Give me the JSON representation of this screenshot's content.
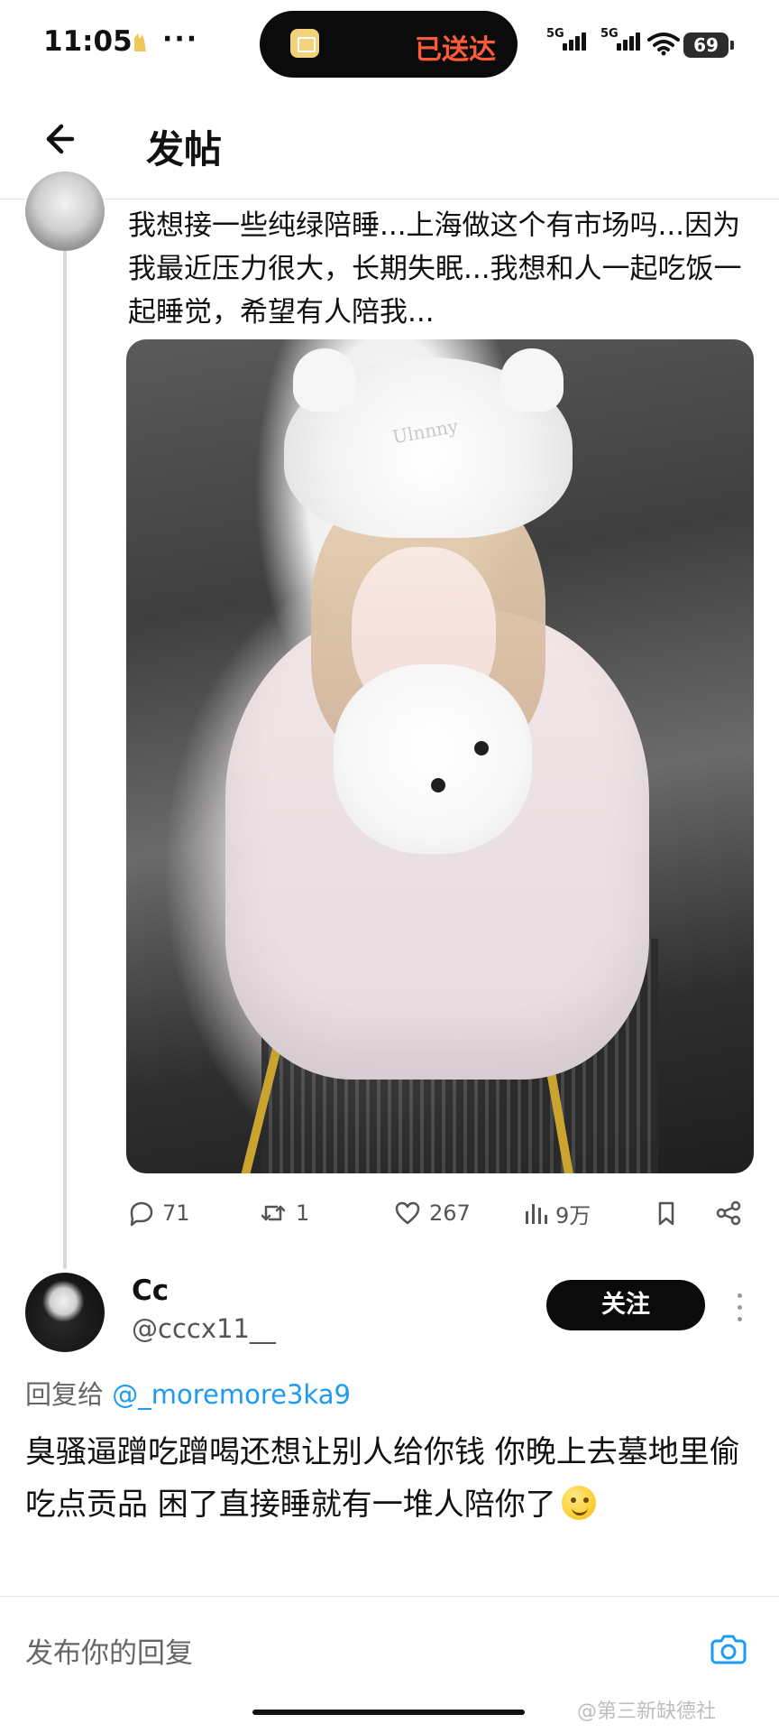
{
  "status_bar": {
    "time": "11:05",
    "more": "···",
    "pill_text": "已送达",
    "signal_1_label": "5G",
    "signal_2_label": "5G",
    "battery": "69",
    "colors": {
      "pill_text": "#ff5b3a"
    }
  },
  "header": {
    "title": "发帖",
    "back_icon": "arrow-left-icon"
  },
  "post": {
    "text": "我想接一些纯绿陪睡...上海做这个有市场吗...因为我最近压力很大，长期失眠...我想和人一起吃饭一起睡觉，希望有人陪我...",
    "image_text": "Ulnnny",
    "stats": {
      "replies": "71",
      "reposts": "1",
      "likes": "267",
      "views": "9万"
    }
  },
  "reply": {
    "name": "Cc",
    "handle": "@cccx11__",
    "follow_label": "关注",
    "replying_to_label": "回复给",
    "mention": "@_moremore3ka9",
    "text": "臭骚逼蹭吃蹭喝还想让别人给你钱  你晚上去墓地里偷吃点贡品 困了直接睡就有一堆人陪你了"
  },
  "composer": {
    "placeholder": "发布你的回复",
    "camera_icon": "camera-icon"
  },
  "watermark": "@第三新缺德社",
  "colors": {
    "link": "#1d9bf0",
    "follow_bg": "#0b0b0b",
    "text": "#111111",
    "muted": "#555555"
  }
}
